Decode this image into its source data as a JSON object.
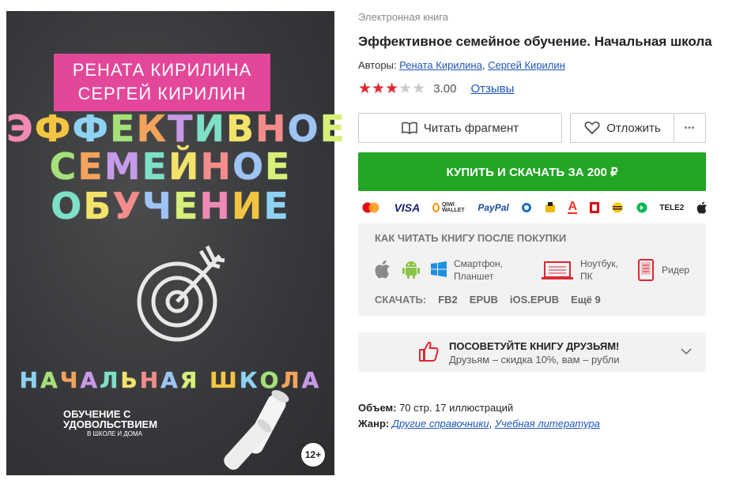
{
  "cover": {
    "author1": "РЕНАТА КИРИЛИНА",
    "author2": "СЕРГЕЙ КИРИЛИН",
    "title_l1": "ЭФФЕКТИВНОЕ",
    "title_l2": "СЕМЕЙНОЕ",
    "title_l3": "ОБУЧЕНИЕ",
    "subtitle": "НАЧАЛЬНАЯ ШКОЛА",
    "logo_l1": "ОБУЧЕНИЕ С",
    "logo_l2": "УДОВОЛЬСТВИЕМ",
    "logo_l3": "В ШКОЛЕ И ДОМА",
    "age": "12+"
  },
  "book": {
    "kind": "Электронная книга",
    "title": "Эффективное семейное обучение. Начальная школа",
    "authors_label": "Авторы:",
    "author1": "Рената Кирилина",
    "sep": ",",
    "author2": "Сергей Кирилин",
    "rating": 3,
    "rating_value": "3.00",
    "reviews": "Отзывы"
  },
  "actions": {
    "read_fragment": "Читать фрагмент",
    "postpone": "Отложить",
    "more": "•••",
    "buy": "КУПИТЬ И СКАЧАТЬ ЗА 200 ₽"
  },
  "payment": {
    "visa": "VISA",
    "qiwi": "QIWI WALLET",
    "paypal": "PayPal",
    "tele2": "TELE2"
  },
  "how_to_read": {
    "header": "КАК ЧИТАТЬ КНИГУ ПОСЛЕ ПОКУПКИ",
    "phone_l1": "Смартфон,",
    "phone_l2": "Планшет",
    "pc_l1": "Ноутбук,",
    "pc_l2": "ПК",
    "reader": "Ридер",
    "download_label": "СКАЧАТЬ:",
    "formats": [
      "FB2",
      "EPUB",
      "iOS.EPUB",
      "Ещё 9"
    ]
  },
  "recommend": {
    "title": "ПОСОВЕТУЙТЕ КНИГУ ДРУЗЬЯМ!",
    "subtitle": "Друзьям – скидка 10%, вам – рубли"
  },
  "details": {
    "volume_label": "Объем:",
    "volume_value": "70 стр. 17 иллюстраций",
    "genre_label": "Жанр:",
    "genre1": "Другие справочники",
    "genre2": "Учебная литература"
  },
  "colors": {
    "buy_green": "#22a624",
    "link_blue": "#1d55b8",
    "star_red": "#e0272f",
    "cover_pink": "#e3479a"
  }
}
